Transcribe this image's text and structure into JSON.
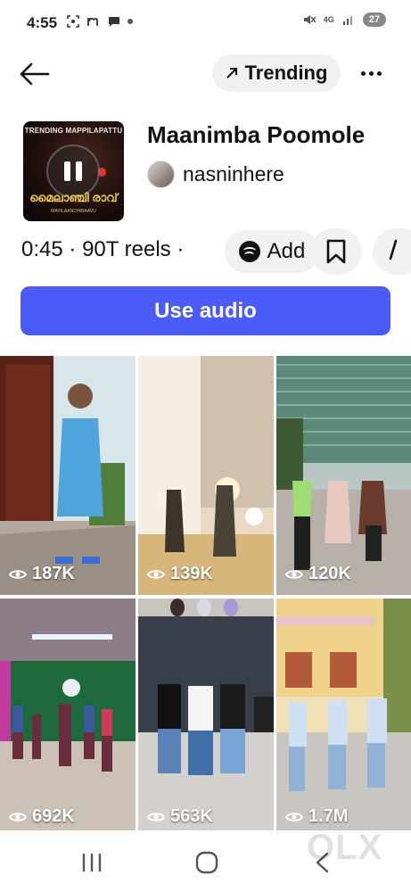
{
  "status": {
    "time": "4:55",
    "network": "4G",
    "battery": "27",
    "icons": [
      "screenshot-icon",
      "m-icon",
      "chat-icon",
      "dot-icon",
      "mute-icon",
      "signal-icon"
    ]
  },
  "header": {
    "trending_label": "Trending",
    "icons": [
      "back-arrow-icon",
      "trending-arrow-icon",
      "more-icon"
    ]
  },
  "audio": {
    "title": "Maanimba Poomole",
    "artist": "nasninhere",
    "duration": "0:45",
    "reels_count": "90T reels",
    "cover_top_text": "TRENDING MAPPILAPATTU",
    "cover_title_text": "മൈലാഞ്ചി രാവ്",
    "cover_sub_text": "MAYILAANCHIRAAVU"
  },
  "actions": {
    "add_label": "Add",
    "use_audio_label": "Use audio",
    "icons": [
      "spotify-icon",
      "bookmark-icon",
      "share-icon",
      "pause-icon"
    ]
  },
  "reels": [
    {
      "views": "187K"
    },
    {
      "views": "139K"
    },
    {
      "views": "120K"
    },
    {
      "views": "692K"
    },
    {
      "views": "563K"
    },
    {
      "views": "1.7M"
    }
  ],
  "watermark": "OLX",
  "nav": {
    "icons": [
      "recent-apps-icon",
      "home-icon",
      "back-icon"
    ]
  }
}
